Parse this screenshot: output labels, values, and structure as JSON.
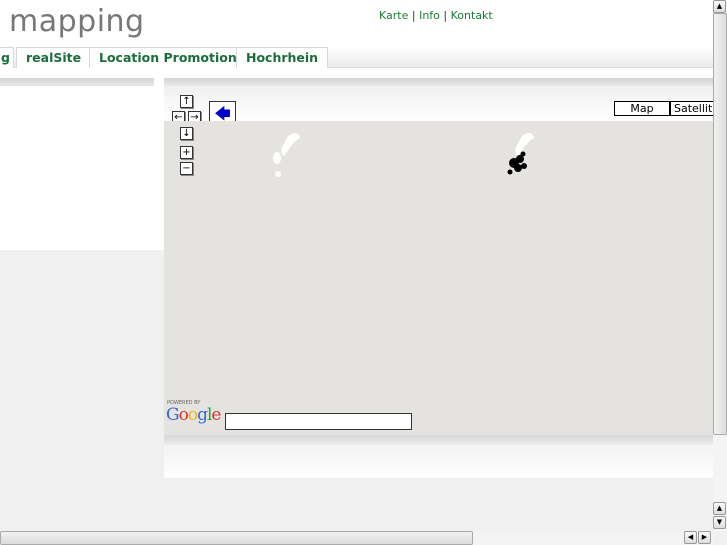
{
  "header": {
    "title": "mapping",
    "links": [
      "Karte",
      "Info",
      "Kontakt"
    ],
    "separator": "|"
  },
  "tabs": [
    {
      "label": "g"
    },
    {
      "label": "realSite"
    },
    {
      "label": "Location Promotion"
    },
    {
      "label": "Hochrhein"
    }
  ],
  "map": {
    "controls": {
      "pan_up": "↑",
      "pan_left": "←",
      "pan_right": "→",
      "pan_down": "↓",
      "zoom_in": "+",
      "zoom_out": "−",
      "back": "🡄"
    },
    "map_types": [
      "Map",
      "Satellite"
    ],
    "powered_by": "POWERED BY",
    "logo": "Google",
    "search_value": "",
    "background": "#e5e3df"
  },
  "colors": {
    "link": "#1b7a3a",
    "title": "#777777"
  }
}
